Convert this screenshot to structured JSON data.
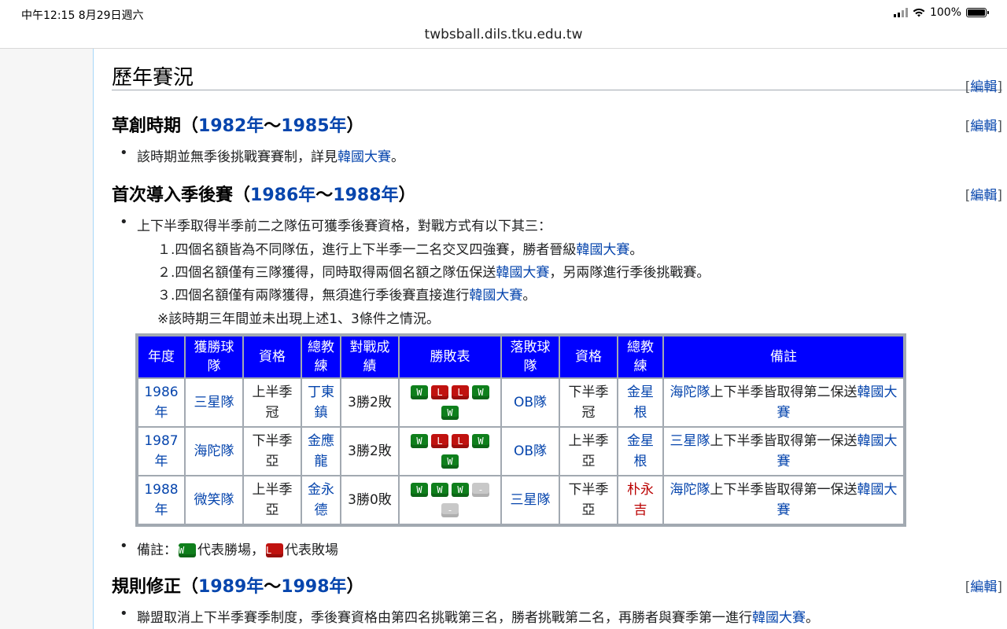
{
  "status": {
    "time": "中午12:15   8月29日週六",
    "battery": "100%"
  },
  "url": "twbsball.dils.tku.edu.tw",
  "section": {
    "title": "歷年賽況",
    "edit": "編輯"
  },
  "period1": {
    "title_prefix": "草創時期（",
    "year_a": "1982年",
    "sep": "～",
    "year_b": "1985年",
    "title_suffix": "）",
    "edit": "編輯",
    "bullet_text": "該時期並無季後挑戰賽賽制，詳見",
    "bullet_link": "韓國大賽",
    "bullet_end": "。"
  },
  "period2": {
    "title_prefix": "首次導入季後賽（",
    "year_a": "1986年",
    "sep": "～",
    "year_b": "1988年",
    "title_suffix": "）",
    "edit": "編輯",
    "bullet_text": "上下半季取得半季前二之隊伍可獲季後賽資格，對戰方式有以下其三：",
    "rule1_text": "１.四個名額皆為不同隊伍，進行上下半季一二名交叉四強賽，勝者晉級",
    "rule1_link": "韓國大賽",
    "rule1_end": "。",
    "rule2_text": "２.四個名額僅有三隊獲得，同時取得兩個名額之隊伍保送",
    "rule2_link": "韓國大賽",
    "rule2_end": "，另兩隊進行季後挑戰賽。",
    "rule3_text": "３.四個名額僅有兩隊獲得，無須進行季後賽直接進行",
    "rule3_link": "韓國大賽",
    "rule3_end": "。",
    "note": "※該時期三年間並未出現上述1、3條件之情況。"
  },
  "table": {
    "headers": [
      "年度",
      "獲勝球隊",
      "資格",
      "總教練",
      "對戰成績",
      "勝敗表",
      "落敗球隊",
      "資格",
      "總教練",
      "備註"
    ],
    "rows": [
      {
        "year": "1986年",
        "winner": "三星隊",
        "winner_q": "上半季冠",
        "winner_coach": "丁東鎮",
        "result": "3勝2敗",
        "games": [
          "W",
          "L",
          "L",
          "W",
          "W"
        ],
        "loser": "OB隊",
        "loser_q": "下半季冠",
        "loser_coach": "金星根",
        "note_link1": "海陀隊",
        "note_text": "上下半季皆取得第二保送",
        "note_link2": "韓國大賽"
      },
      {
        "year": "1987年",
        "winner": "海陀隊",
        "winner_q": "下半季亞",
        "winner_coach": "金應龍",
        "result": "3勝2敗",
        "games": [
          "W",
          "L",
          "L",
          "W",
          "W"
        ],
        "loser": "OB隊",
        "loser_q": "上半季亞",
        "loser_coach": "金星根",
        "note_link1": "三星隊",
        "note_text": "上下半季皆取得第一保送",
        "note_link2": "韓國大賽"
      },
      {
        "year": "1988年",
        "winner": "微笑隊",
        "winner_q": "上半季亞",
        "winner_coach": "金永德",
        "result": "3勝0敗",
        "games": [
          "W",
          "W",
          "W",
          "-",
          "-"
        ],
        "loser": "三星隊",
        "loser_q": "下半季亞",
        "loser_coach": "朴永吉",
        "note_link1": "海陀隊",
        "note_text": "上下半季皆取得第一保送",
        "note_link2": "韓國大賽"
      }
    ],
    "badge_w": "W",
    "badge_l": "L",
    "badge_d": "-"
  },
  "legend": {
    "prefix": "備註：",
    "win_text": "代表勝場，",
    "loss_text": "代表敗場"
  },
  "period3": {
    "title_prefix": "規則修正（",
    "year_a": "1989年",
    "sep": "～",
    "year_b": "1998年",
    "title_suffix": "）",
    "edit": "編輯",
    "bullet_text": "聯盟取消上下半季賽季制度，季後賽資格由第四名挑戰第三名，勝者挑戰第二名，再勝者與賽季第一進行",
    "bullet_link": "韓國大賽",
    "bullet_end": "。"
  },
  "colors": {
    "link": "#0645ad",
    "header_bg": "#0000ff",
    "win": "#0f7f1c",
    "loss": "#c0120f",
    "redlink": "#ba0000"
  }
}
